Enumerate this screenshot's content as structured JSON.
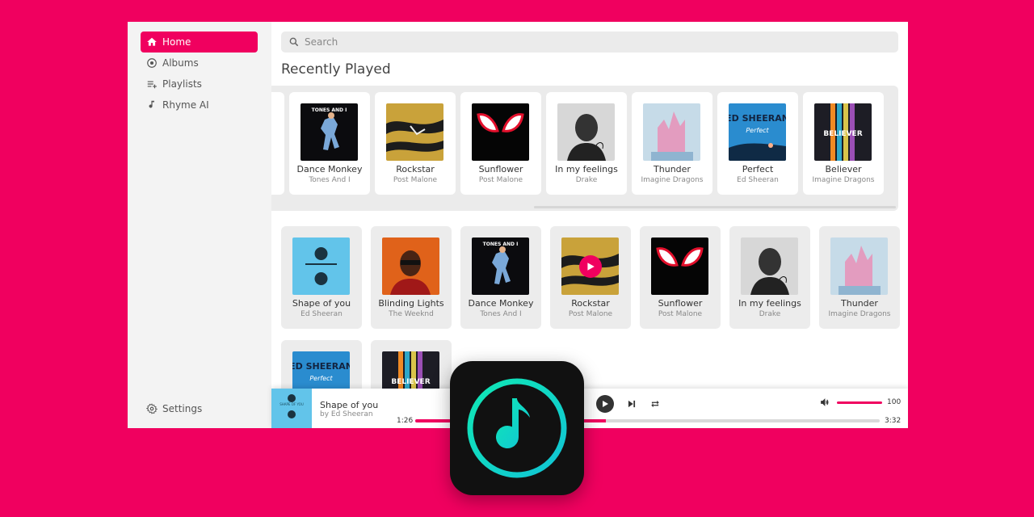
{
  "accent": "#f0005f",
  "sidebar": {
    "items": [
      {
        "label": "Home",
        "icon": "home-icon",
        "active": true
      },
      {
        "label": "Albums",
        "icon": "album-icon",
        "active": false
      },
      {
        "label": "Playlists",
        "icon": "playlist-add-icon",
        "active": false
      },
      {
        "label": "Rhyme AI",
        "icon": "music-note-icon",
        "active": false
      }
    ],
    "settings_label": "Settings"
  },
  "search": {
    "placeholder": "Search"
  },
  "recent": {
    "title": "Recently Played",
    "items": [
      {
        "title": "",
        "artist": "",
        "cover": "partial"
      },
      {
        "title": "Dance Monkey",
        "artist": "Tones And I",
        "cover": "dance"
      },
      {
        "title": "Rockstar",
        "artist": "Post Malone",
        "cover": "rockstar"
      },
      {
        "title": "Sunflower",
        "artist": "Post Malone",
        "cover": "sunflower"
      },
      {
        "title": "In my feelings",
        "artist": "Drake",
        "cover": "drake"
      },
      {
        "title": "Thunder",
        "artist": "Imagine Dragons",
        "cover": "thunder"
      },
      {
        "title": "Perfect",
        "artist": "Ed Sheeran",
        "cover": "perfect"
      },
      {
        "title": "Believer",
        "artist": "Imagine Dragons",
        "cover": "believer"
      }
    ]
  },
  "grid": {
    "items": [
      {
        "title": "Shape of you",
        "artist": "Ed Sheeran",
        "cover": "divide"
      },
      {
        "title": "Blinding Lights",
        "artist": "The Weeknd",
        "cover": "weeknd"
      },
      {
        "title": "Dance Monkey",
        "artist": "Tones And I",
        "cover": "dance"
      },
      {
        "title": "Rockstar",
        "artist": "Post Malone",
        "cover": "rockstar",
        "playing": true
      },
      {
        "title": "Sunflower",
        "artist": "Post Malone",
        "cover": "sunflower"
      },
      {
        "title": "In my feelings",
        "artist": "Drake",
        "cover": "drake"
      },
      {
        "title": "Thunder",
        "artist": "Imagine Dragons",
        "cover": "thunder"
      },
      {
        "title": "",
        "artist": "",
        "cover": "perfect"
      },
      {
        "title": "",
        "artist": "",
        "cover": "believer"
      }
    ]
  },
  "cover_text": {
    "dance": "TONES AND I",
    "perfect": "ED SHEERAN",
    "believer": "BELIEVER"
  },
  "player": {
    "title": "Shape of you",
    "artist": "by Ed Sheeran",
    "elapsed": "1:26",
    "duration": "3:32",
    "progress": 0.41,
    "volume": 100,
    "volume_label": "100"
  }
}
